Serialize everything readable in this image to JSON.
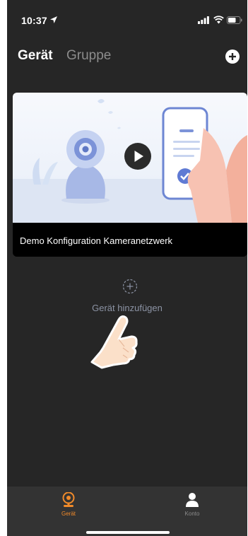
{
  "status_bar": {
    "time": "10:37"
  },
  "header": {
    "tab_device": "Gerät",
    "tab_group": "Gruppe"
  },
  "demo_card": {
    "caption": "Demo Konfiguration Kameranetzwerk"
  },
  "empty_state": {
    "add_device_label": "Gerät hinzufügen"
  },
  "tab_bar": {
    "items": [
      {
        "label": "Gerät"
      },
      {
        "label": "Konto"
      }
    ]
  },
  "colors": {
    "accent": "#f08a2a",
    "background": "#262626",
    "tab_bar": "#333333",
    "muted_text": "#8c93a4"
  },
  "icons": [
    "location-arrow-icon",
    "signal-icon",
    "wifi-icon",
    "battery-icon",
    "add-circle-icon",
    "play-icon",
    "add-dashed-circle-icon",
    "pointing-hand-icon",
    "camera-tab-icon",
    "person-icon"
  ]
}
